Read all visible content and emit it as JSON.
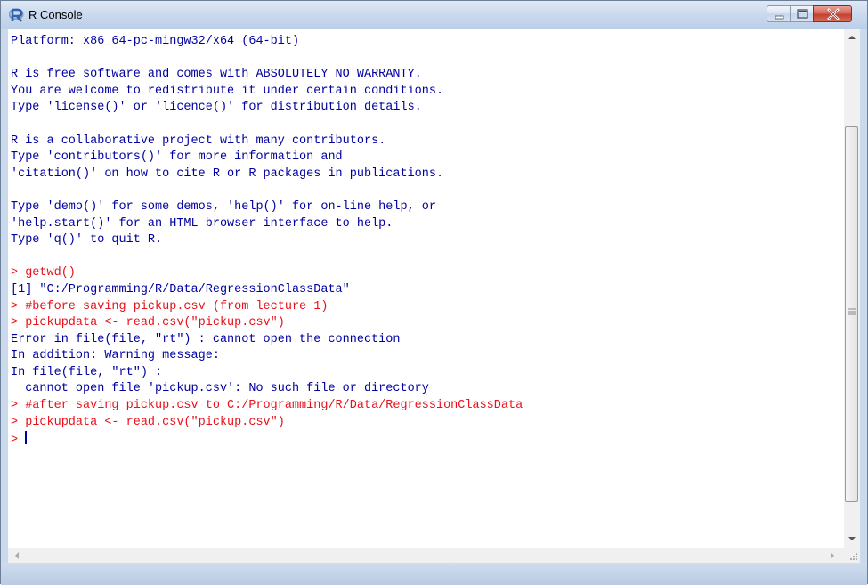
{
  "window": {
    "title": "R Console",
    "icon": "r-logo-icon",
    "controls": [
      "minimize-icon",
      "maximize-icon",
      "close-icon"
    ]
  },
  "console": {
    "lines": [
      {
        "kind": "out",
        "text": "Platform: x86_64-pc-mingw32/x64 (64-bit)"
      },
      {
        "kind": "out",
        "text": ""
      },
      {
        "kind": "out",
        "text": "R is free software and comes with ABSOLUTELY NO WARRANTY."
      },
      {
        "kind": "out",
        "text": "You are welcome to redistribute it under certain conditions."
      },
      {
        "kind": "out",
        "text": "Type 'license()' or 'licence()' for distribution details."
      },
      {
        "kind": "out",
        "text": ""
      },
      {
        "kind": "out",
        "text": "R is a collaborative project with many contributors."
      },
      {
        "kind": "out",
        "text": "Type 'contributors()' for more information and"
      },
      {
        "kind": "out",
        "text": "'citation()' on how to cite R or R packages in publications."
      },
      {
        "kind": "out",
        "text": ""
      },
      {
        "kind": "out",
        "text": "Type 'demo()' for some demos, 'help()' for on-line help, or"
      },
      {
        "kind": "out",
        "text": "'help.start()' for an HTML browser interface to help."
      },
      {
        "kind": "out",
        "text": "Type 'q()' to quit R."
      },
      {
        "kind": "out",
        "text": ""
      },
      {
        "kind": "in",
        "text": "> getwd()"
      },
      {
        "kind": "out",
        "text": "[1] \"C:/Programming/R/Data/RegressionClassData\""
      },
      {
        "kind": "in",
        "text": "> #before saving pickup.csv (from lecture 1)"
      },
      {
        "kind": "in",
        "text": "> pickupdata <- read.csv(\"pickup.csv\")"
      },
      {
        "kind": "out",
        "text": "Error in file(file, \"rt\") : cannot open the connection"
      },
      {
        "kind": "out",
        "text": "In addition: Warning message:"
      },
      {
        "kind": "out",
        "text": "In file(file, \"rt\") :"
      },
      {
        "kind": "out",
        "text": "  cannot open file 'pickup.csv': No such file or directory"
      },
      {
        "kind": "in",
        "text": "> #after saving pickup.csv to C:/Programming/R/Data/RegressionClassData"
      },
      {
        "kind": "in",
        "text": "> pickupdata <- read.csv(\"pickup.csv\")"
      }
    ],
    "prompt": "> "
  },
  "scrollbars": {
    "vertical_icons": [
      "scroll-up-arrow-icon",
      "scroll-down-arrow-icon"
    ],
    "horizontal_icons": [
      "scroll-left-arrow-icon",
      "scroll-right-arrow-icon",
      "resize-grip-icon"
    ]
  },
  "colors": {
    "output_text": "#0000a0",
    "input_text": "#e8101a",
    "console_bg": "#ffffff"
  }
}
